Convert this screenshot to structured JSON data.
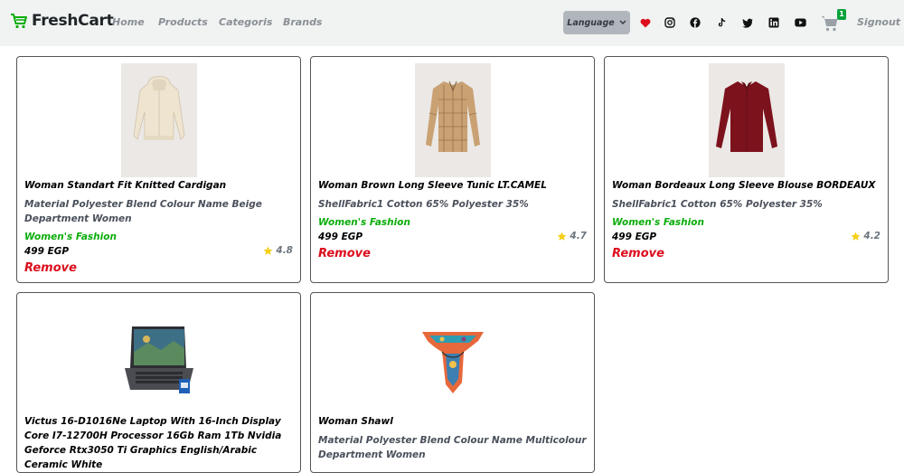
{
  "navbar": {
    "brand": "FreshCart",
    "links": [
      "Home",
      "Products",
      "Categoris",
      "Brands"
    ],
    "language_label": "Language",
    "icons": [
      "heart-icon",
      "instagram-icon",
      "facebook-icon",
      "tiktok-icon",
      "twitter-icon",
      "linkedin-icon",
      "youtube-icon"
    ],
    "cart_count": "1",
    "signout": "Signout"
  },
  "colors": {
    "brand_green": "#0aad0a",
    "remove_red": "#dc0f1e",
    "heart_red": "#dc0f1e",
    "star": "#f5d01c"
  },
  "cards": [
    {
      "title": "Woman Standart Fit Knitted Cardigan",
      "description": "Material Polyester Blend Colour Name Beige Department Women",
      "category": "Women's Fashion",
      "price": "499 EGP",
      "rating": "4.8",
      "remove": "Remove"
    },
    {
      "title": "Woman Brown Long Sleeve Tunic LT.CAMEL",
      "description": "ShellFabric1 Cotton 65% Polyester 35%",
      "category": "Women's Fashion",
      "price": "499 EGP",
      "rating": "4.7",
      "remove": "Remove"
    },
    {
      "title": "Woman Bordeaux Long Sleeve Blouse BORDEAUX",
      "description": "ShellFabric1 Cotton 65% Polyester 35%",
      "category": "Women's Fashion",
      "price": "499 EGP",
      "rating": "4.2",
      "remove": "Remove"
    },
    {
      "title": "Victus 16-D1016Ne Laptop With 16-Inch Display Core I7-12700H Processor 16Gb Ram 1Tb Nvidia Geforce Rtx3050 Ti Graphics English/Arabic Ceramic White"
    },
    {
      "title": "Woman Shawl",
      "description": "Material Polyester Blend Colour Name Multicolour Department Women"
    }
  ]
}
